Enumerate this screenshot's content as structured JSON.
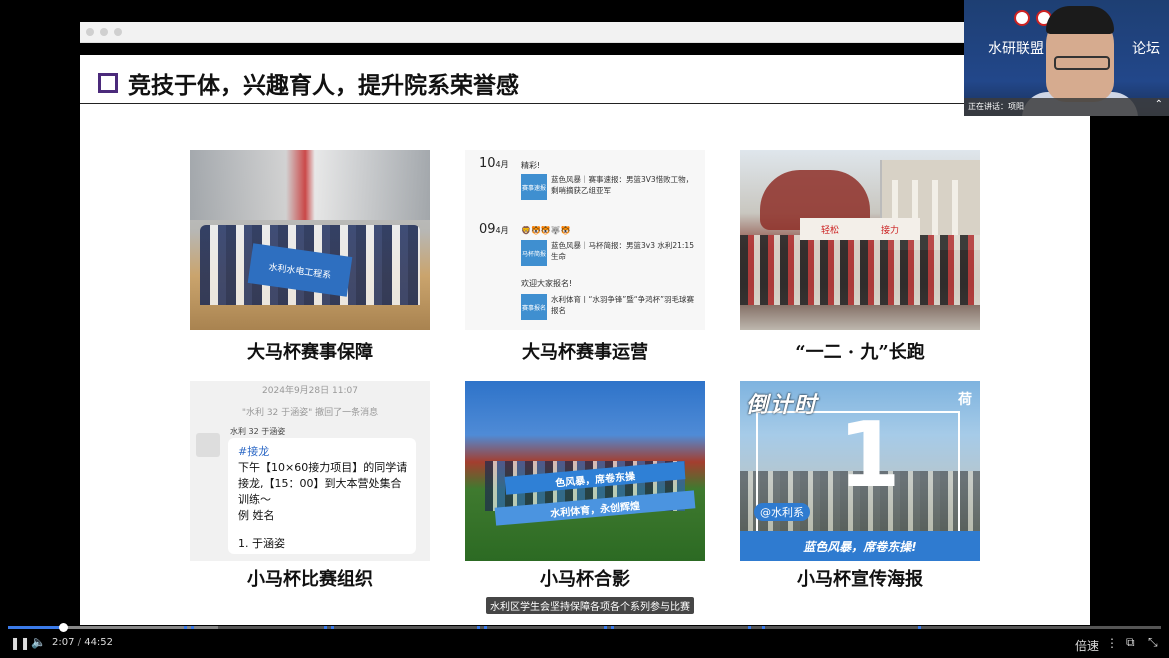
{
  "slide": {
    "title": "竞技于体，兴趣育人，提升院系荣誉感",
    "cards": [
      {
        "caption": "大马杯赛事保障",
        "banner": "水利水电工程系"
      },
      {
        "caption": "大马杯赛事运营"
      },
      {
        "caption": "“一二 · 九”长跑",
        "banner_left": "轻松",
        "banner_right": "接力"
      },
      {
        "caption": "小马杯比赛组织"
      },
      {
        "caption": "小马杯合影",
        "banner1": "色风暴，席卷东操",
        "banner2": "水利体育，永创辉煌"
      },
      {
        "caption": "小马杯宣传海报"
      }
    ],
    "feed": {
      "date1_day": "10",
      "date1_month": "4月",
      "head1": "精彩!",
      "item1_thumb": "赛事速报",
      "item1_text": "蓝色风暴｜赛事速报：男篮3V3惜败工物，剩哨摘获乙组亚军",
      "date2_day": "09",
      "date2_month": "4月",
      "head2": "🦁🐯🐯🐺🐯",
      "item2_thumb": "马杯简报",
      "item2_text": "蓝色风暴｜马杯简报：男篮3v3 水利21:15生命",
      "head3": "欢迎大家报名!",
      "item3_thumb": "赛事报名",
      "item3_text": "水利体育丨“水羽争锋”暨“争鸿杯”羽毛球赛报名"
    },
    "chat": {
      "timestamp": "2024年9月28日 11:07",
      "recall": "\"水利 32 于涵姿\" 撤回了一条消息",
      "sender": "水利 32 于涵姿",
      "tag": "#接龙",
      "line1": "下午【10×60接力项目】的同学请",
      "line2": "接龙,【15：00】到大本营处集合",
      "line3": "训练～",
      "line4": "例 姓名",
      "line5": "1. 于涵姿"
    },
    "poster": {
      "title": "倒计时",
      "number": "1",
      "tag": "@水利系",
      "bottom": "蓝色风暴，席卷东操!",
      "logo": "荷"
    }
  },
  "video_overlay": {
    "header_left": "水研联盟",
    "header_right": "论坛",
    "speaker_label": "正在讲话：项阳"
  },
  "subtitle": "水利区学生会坚持保障各项各个系列参与比赛",
  "player": {
    "current_time": "2:07",
    "total_time": "44:52",
    "progress_fraction": 0.047,
    "speed_label": "倍速",
    "icons": [
      "pause-icon",
      "volume-icon",
      "more-icon",
      "pip-icon",
      "exit-fullscreen-icon"
    ]
  }
}
